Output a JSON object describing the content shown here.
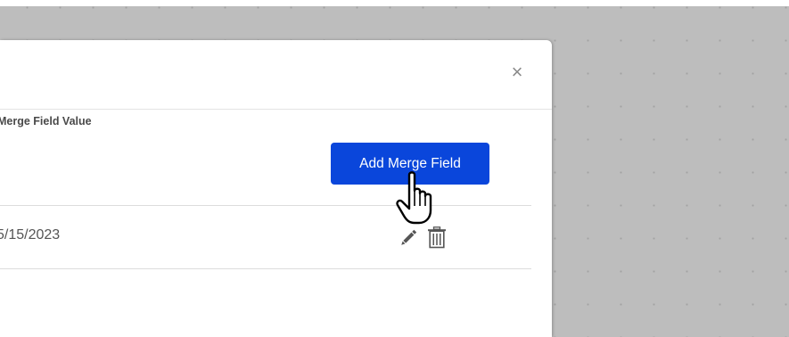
{
  "dialog": {
    "close_label": "×"
  },
  "table": {
    "column_header": "Merge Field Value",
    "rows": [
      {
        "value": "5/15/2023"
      }
    ]
  },
  "add_button": {
    "label": "Add Merge Field",
    "color": "#0a46db"
  },
  "row_actions": {
    "edit_icon": "pencil-icon",
    "delete_icon": "trash-icon"
  },
  "cursor": {
    "icon": "hand-pointer-icon"
  }
}
